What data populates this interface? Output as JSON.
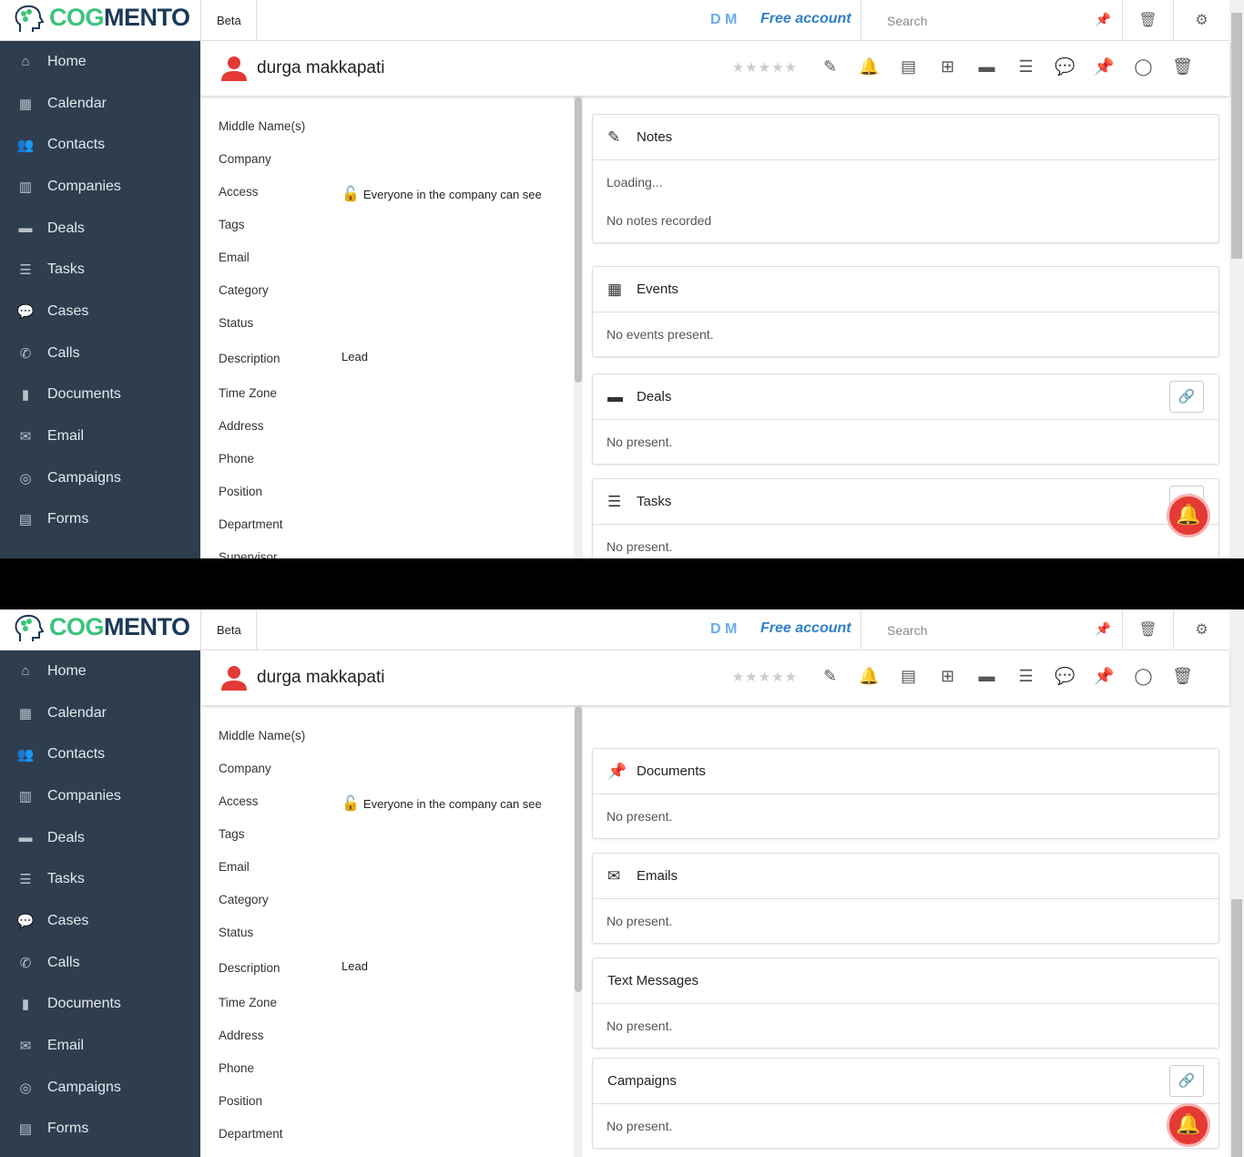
{
  "topbar": {
    "logo_green": "COG",
    "logo_dark": "MENTO",
    "beta": "Beta",
    "initials": "D M",
    "account": "Free account",
    "search_placeholder": "Search"
  },
  "sidebar": {
    "items": [
      {
        "label": "Home",
        "icon": "home-icon",
        "glyph": "⌂"
      },
      {
        "label": "Calendar",
        "icon": "calendar-icon",
        "glyph": "▦"
      },
      {
        "label": "Contacts",
        "icon": "contacts-icon",
        "glyph": "👥"
      },
      {
        "label": "Companies",
        "icon": "building-icon",
        "glyph": "▥"
      },
      {
        "label": "Deals",
        "icon": "money-icon",
        "glyph": "▬"
      },
      {
        "label": "Tasks",
        "icon": "tasks-icon",
        "glyph": "☰"
      },
      {
        "label": "Cases",
        "icon": "comments-icon",
        "glyph": "💬"
      },
      {
        "label": "Calls",
        "icon": "phone-icon",
        "glyph": "✆"
      },
      {
        "label": "Documents",
        "icon": "document-icon",
        "glyph": "▮"
      },
      {
        "label": "Email",
        "icon": "envelope-icon",
        "glyph": "✉"
      },
      {
        "label": "Campaigns",
        "icon": "bullseye-icon",
        "glyph": "◎"
      },
      {
        "label": "Forms",
        "icon": "form-icon",
        "glyph": "▤"
      }
    ]
  },
  "contact": {
    "name": "durga makkapati"
  },
  "fields": [
    {
      "label": "Middle Name(s)",
      "value": ""
    },
    {
      "label": "Company",
      "value": ""
    },
    {
      "label": "Access",
      "value": "Everyone in the company can see"
    },
    {
      "label": "Tags",
      "value": ""
    },
    {
      "label": "Email",
      "value": ""
    },
    {
      "label": "Category",
      "value": ""
    },
    {
      "label": "Status",
      "value": ""
    },
    {
      "label": "Description",
      "value": "Lead"
    },
    {
      "label": "Time Zone",
      "value": ""
    },
    {
      "label": "Address",
      "value": ""
    },
    {
      "label": "Phone",
      "value": ""
    },
    {
      "label": "Position",
      "value": ""
    },
    {
      "label": "Department",
      "value": ""
    },
    {
      "label": "Supervisor",
      "value": ""
    }
  ],
  "cards_view1": [
    {
      "title": "Notes",
      "icon": "edit-icon",
      "glyph": "✎",
      "lines": [
        "Loading...",
        "No notes recorded"
      ]
    },
    {
      "title": "Events",
      "icon": "calendar-icon",
      "glyph": "▦",
      "lines": [
        "No events present."
      ]
    },
    {
      "title": "Deals",
      "icon": "money-icon",
      "glyph": "▬",
      "lines": [
        "No present."
      ],
      "link": true
    },
    {
      "title": "Tasks",
      "icon": "tasks-icon",
      "glyph": "☰",
      "lines": [
        "No present."
      ],
      "link": true
    }
  ],
  "cards_view2": [
    {
      "title": "",
      "icon": "",
      "glyph": "",
      "lines": [
        "No present."
      ]
    },
    {
      "title": "Documents",
      "icon": "pin-icon",
      "glyph": "📌",
      "lines": [
        "No present."
      ]
    },
    {
      "title": "Emails",
      "icon": "envelope-icon",
      "glyph": "✉",
      "lines": [
        "No present."
      ]
    },
    {
      "title": "Text Messages",
      "icon": "",
      "glyph": "",
      "lines": [
        "No present."
      ]
    },
    {
      "title": "Campaigns",
      "icon": "",
      "glyph": "",
      "lines": [
        "No present."
      ],
      "link": true
    }
  ],
  "colors": {
    "sidebar": "#2e3e4f",
    "accent": "#2f80c8",
    "notify": "#e53935"
  }
}
